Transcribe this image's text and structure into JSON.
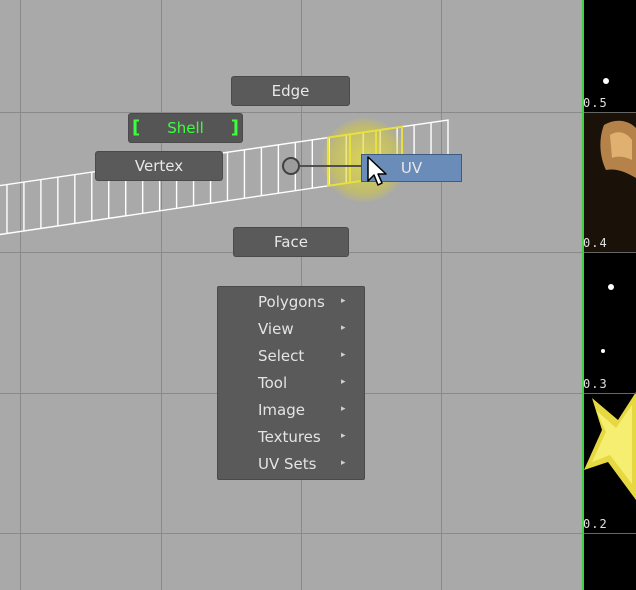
{
  "hotbox": {
    "edge_label": "Edge",
    "shell_label": "Shell",
    "vertex_label": "Vertex",
    "uv_label": "UV",
    "face_label": "Face",
    "bracket_left": "[",
    "bracket_right": "]"
  },
  "menu": {
    "items": [
      {
        "label": "Polygons",
        "arrow": "▸"
      },
      {
        "label": "View",
        "arrow": "▸"
      },
      {
        "label": "Select",
        "arrow": "▸"
      },
      {
        "label": "Tool",
        "arrow": "▸"
      },
      {
        "label": "Image",
        "arrow": "▸"
      },
      {
        "label": "Textures",
        "arrow": "▸"
      },
      {
        "label": "UV Sets",
        "arrow": "▸"
      }
    ]
  },
  "texture_axis": {
    "labels": [
      "0.5",
      "0.4",
      "0.3",
      "0.2"
    ]
  },
  "colors": {
    "selection_green": "#3cff3c",
    "uv_blue": "#6a8cb8",
    "highlight_yellow": "#e8e03c",
    "border_green": "#42d142"
  },
  "icons": {
    "cursor": "arrow-pointer-icon",
    "submenu": "submenu-arrow-icon"
  }
}
